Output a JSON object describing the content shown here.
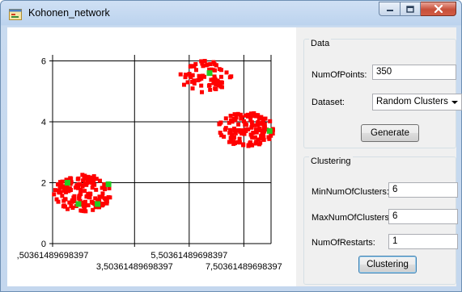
{
  "window": {
    "title": "Kohonen_network",
    "icon": "app-form-icon",
    "buttons": [
      "minimize-icon",
      "maximize-icon",
      "close-icon"
    ]
  },
  "chart_data": {
    "type": "scatter",
    "title": "",
    "xlabel": "",
    "ylabel": "",
    "xlim": [
      0.50361489698397,
      8.5
    ],
    "ylim": [
      0,
      6.2
    ],
    "y_ticks": [
      "0",
      "2",
      "4",
      "6"
    ],
    "y_tick_values": [
      0,
      2,
      4,
      6
    ],
    "x_ticks": [
      ",50361489698397",
      "3,50361489698397",
      "5,50361489698397",
      "7,50361489698397"
    ],
    "x_tick_values": [
      0.50361489698397,
      3.50361489698397,
      5.50361489698397,
      7.50361489698397
    ],
    "x_tick_rows": [
      0,
      1,
      0,
      1
    ],
    "grid": true,
    "series": [
      {
        "color": "#ff0000",
        "marker": "square",
        "clusters": [
          {
            "center": [
              6.1,
              5.5
            ],
            "spread": [
              0.95,
              0.55
            ],
            "count": 70
          },
          {
            "center": [
              7.6,
              3.75
            ],
            "spread": [
              1.05,
              0.55
            ],
            "count": 130
          },
          {
            "center": [
              1.6,
              1.65
            ],
            "spread": [
              1.05,
              0.62
            ],
            "count": 150
          }
        ]
      },
      {
        "color": "#22cc22",
        "marker": "square",
        "points": [
          [
            1.05,
            2.0
          ],
          [
            2.55,
            1.95
          ],
          [
            1.45,
            1.3
          ],
          [
            2.15,
            1.3
          ],
          [
            6.25,
            5.6
          ],
          [
            8.45,
            3.7
          ]
        ]
      }
    ]
  },
  "data_group": {
    "title": "Data",
    "num_points_label": "NumOfPoints:",
    "num_points_value": "350",
    "dataset_label": "Dataset:",
    "dataset_value": "Random Clusters",
    "generate_label": "Generate"
  },
  "clustering_group": {
    "title": "Clustering",
    "min_label": "MinNumOfClusters:",
    "min_value": "6",
    "max_label": "MaxNumOfClusters:",
    "max_value": "6",
    "restarts_label": "NumOfRestarts:",
    "restarts_value": "1",
    "clustering_label": "Clustering"
  }
}
